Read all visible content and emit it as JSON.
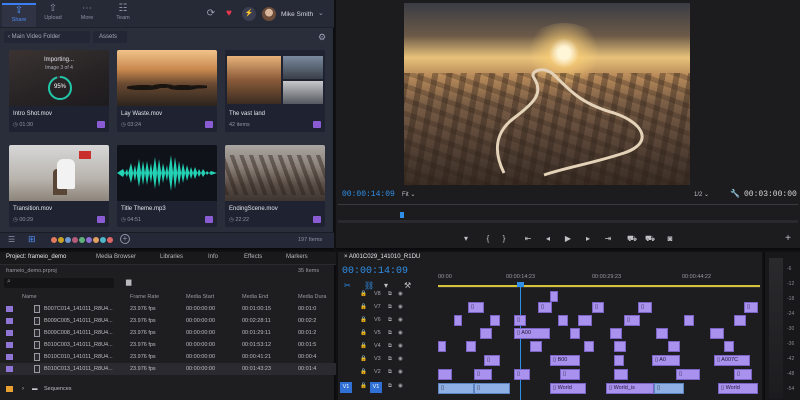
{
  "frameio": {
    "toolbar": [
      {
        "label": "Share",
        "icon": "share-icon",
        "glyph": "⇪"
      },
      {
        "label": "Upload",
        "icon": "upload-icon",
        "glyph": "⇧"
      },
      {
        "label": "More",
        "icon": "more-icon",
        "glyph": "⋯"
      },
      {
        "label": "Team",
        "icon": "team-icon",
        "glyph": "☷"
      }
    ],
    "user_name": "Mike Smith",
    "breadcrumb": "Main Video Folder",
    "breadcrumb_sub": "Assets",
    "cards": [
      {
        "title": "Intro Shot.mov",
        "meta": "01:30",
        "progress_label": "Importing...",
        "progress_sub": "Image 3 of 4",
        "progress_value": "95%",
        "progress_fraction": 0.95
      },
      {
        "title": "Lay Waste.mov",
        "meta": "03:24"
      },
      {
        "title": "The vast land",
        "meta": "42 items"
      },
      {
        "title": "Transition.mov",
        "meta": "00:29"
      },
      {
        "title": "Title Theme.mp3",
        "meta": "04:51"
      },
      {
        "title": "EndingScene.mov",
        "meta": "22:22"
      }
    ],
    "item_count": "197 Items",
    "accent": "#3b7ef0"
  },
  "program": {
    "timecode_in": "00:00:14:09",
    "fit_label": "Fit",
    "resolution": "1/2",
    "duration": "00:03:00:00"
  },
  "project": {
    "tabs": [
      "Project: frameio_demo",
      "Media Browser",
      "Libraries",
      "Info",
      "Effects",
      "Markers"
    ],
    "file": "frameio_demo.prproj",
    "item_count": "35 Items",
    "columns": [
      "Name",
      "Frame Rate",
      "Media Start",
      "Media End",
      "Media Dura"
    ],
    "rows": [
      {
        "name": "B007C014_141011_R8U4...",
        "rate": "23.976 fps",
        "start": "00:00:00:00",
        "end": "00:01:00:15",
        "dur": "00:01:0"
      },
      {
        "name": "B009C005_141011_R8U4...",
        "rate": "23.976 fps",
        "start": "00:00:00:00",
        "end": "00:02:28:11",
        "dur": "00:02:2"
      },
      {
        "name": "B009C008_141011_R8U4...",
        "rate": "23.976 fps",
        "start": "00:00:00:00",
        "end": "00:01:29:11",
        "dur": "00:01:2"
      },
      {
        "name": "B010C003_141011_R8U4...",
        "rate": "23.976 fps",
        "start": "00:00:00:00",
        "end": "00:01:53:12",
        "dur": "00:01:5"
      },
      {
        "name": "B010C010_141011_R8U4...",
        "rate": "23.976 fps",
        "start": "00:00:00:00",
        "end": "00:00:41:21",
        "dur": "00:00:4"
      },
      {
        "name": "B010C013_141011_R8U4...",
        "rate": "23.976 fps",
        "start": "00:00:00:00",
        "end": "00:01:43:23",
        "dur": "00:01:4"
      }
    ],
    "folder": "Sequences",
    "swatch_color": "#8f76d6"
  },
  "timeline": {
    "sequence": "A001C029_141010_R1DU",
    "timecode": "00:00:14:09",
    "ruler": [
      "00:00",
      "00:00:14:23",
      "00:00:29:23",
      "00:00:44:22"
    ],
    "tracks": [
      "V8",
      "V7",
      "V6",
      "V5",
      "V4",
      "V3",
      "V2",
      "V1"
    ],
    "clip_labels": [
      "A00",
      "B00",
      "A0",
      "A007C",
      "World",
      "World_is",
      "World"
    ],
    "meter_ticks": [
      "-6",
      "-12",
      "-18",
      "-24",
      "-30",
      "-36",
      "-42",
      "-48",
      "-54"
    ]
  }
}
